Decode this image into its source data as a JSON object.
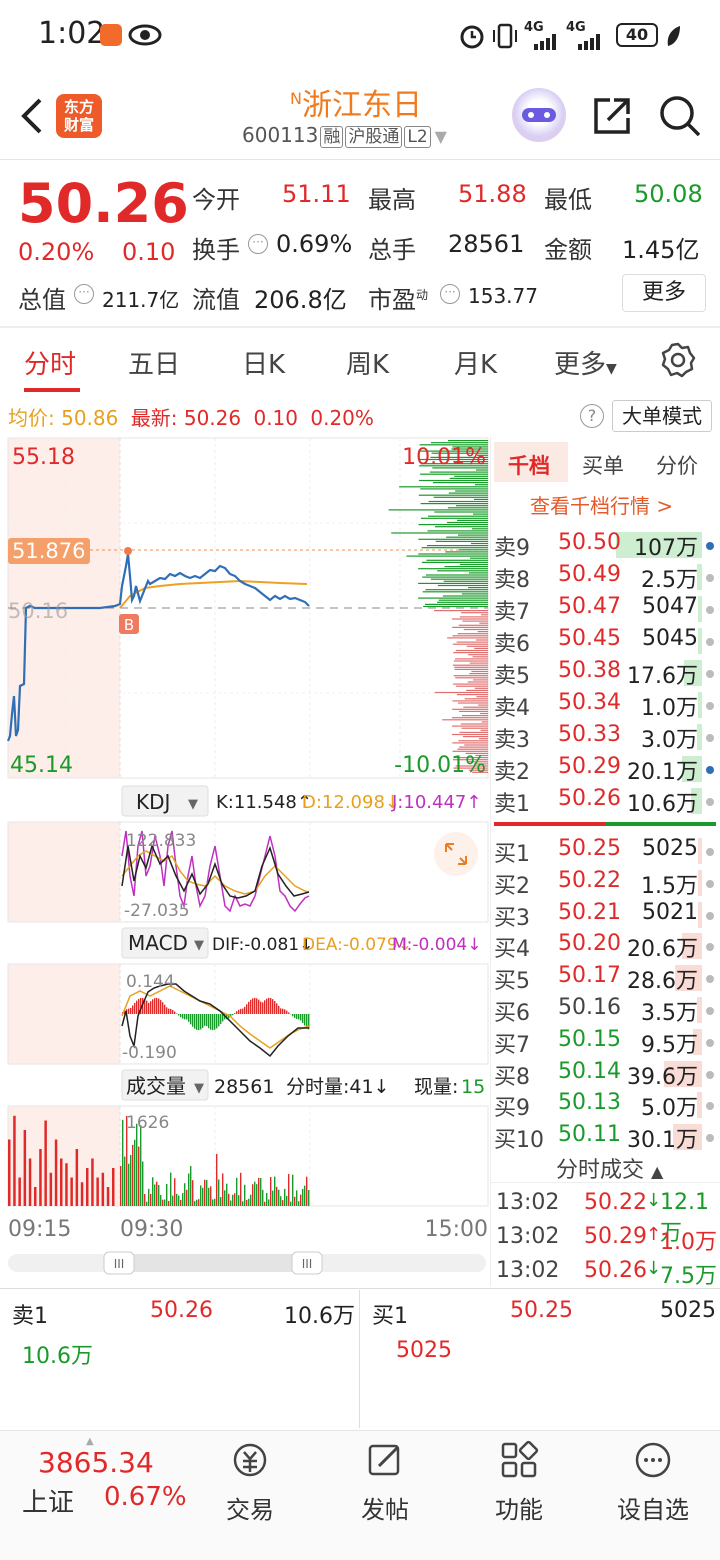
{
  "status": {
    "time": "1:02",
    "battery": "40",
    "net1": "4G",
    "net2": "4G"
  },
  "header": {
    "app_logo": [
      "东方",
      "财富"
    ],
    "name_prefix": "N",
    "name": "浙江东日",
    "code": "600113",
    "tags": [
      "融",
      "沪股通",
      "L2"
    ]
  },
  "quote": {
    "price": "50.26",
    "pct": "0.20%",
    "chg": "0.10",
    "open_label": "今开",
    "open": "51.11",
    "high_label": "最高",
    "high": "51.88",
    "low_label": "最低",
    "low": "50.08",
    "turnover_label": "换手",
    "turnover": "0.69%",
    "vol_label": "总手",
    "vol": "28561",
    "amount_label": "金额",
    "amount": "1.45亿",
    "mcap_label": "总值",
    "mcap": "211.7亿",
    "float_label": "流值",
    "float": "206.8亿",
    "pe_label": "市盈",
    "pe_sup": "动",
    "pe": "153.77",
    "more": "更多"
  },
  "tabs": [
    "分时",
    "五日",
    "日K",
    "周K",
    "月K",
    "更多"
  ],
  "avg_row": {
    "avg_label": "均价:",
    "avg": "50.86",
    "latest_label": "最新:",
    "latest": "50.26",
    "chg": "0.10",
    "pct": "0.20%"
  },
  "big_order_btn": "大单模式",
  "chart": {
    "y_top": "55.18",
    "y_bottom": "45.14",
    "pct_top": "10.01%",
    "pct_bottom": "-10.01%",
    "marker_price": "51.876",
    "base_price": "50.16",
    "b_marker": "B",
    "kdj": {
      "name": "KDJ",
      "k": "K:11.548↑",
      "d": "D:12.098↓",
      "j": "J:10.447↑",
      "max": "122.833",
      "min": "-27.035"
    },
    "macd": {
      "name": "MACD",
      "dif": "DIF:-0.081↓",
      "dea": "DEA:-0.079↓",
      "m": "M:-0.004↓",
      "max": "0.144",
      "min": "-0.190"
    },
    "vol": {
      "name": "成交量",
      "total": "28561",
      "tick_label": "分时量:41↓",
      "now_label": "现量:",
      "now": "15",
      "max": "1626"
    },
    "time_start": "09:15",
    "time_mid": "09:30",
    "time_end": "15:00"
  },
  "orderbook": {
    "tabs": [
      "千档",
      "买单",
      "分价"
    ],
    "link": "查看千档行情 >",
    "asks": [
      {
        "label": "卖9",
        "price": "50.50",
        "vol": "107万",
        "bar": 0.95,
        "color": "red"
      },
      {
        "label": "卖8",
        "price": "50.49",
        "vol": "2.5万",
        "bar": 0.05,
        "color": "red"
      },
      {
        "label": "卖7",
        "price": "50.47",
        "vol": "5047",
        "bar": 0.01,
        "color": "red"
      },
      {
        "label": "卖6",
        "price": "50.45",
        "vol": "5045",
        "bar": 0.01,
        "color": "red"
      },
      {
        "label": "卖5",
        "price": "50.38",
        "vol": "17.6万",
        "bar": 0.2,
        "color": "red"
      },
      {
        "label": "卖4",
        "price": "50.34",
        "vol": "1.0万",
        "bar": 0.03,
        "color": "red"
      },
      {
        "label": "卖3",
        "price": "50.33",
        "vol": "3.0万",
        "bar": 0.05,
        "color": "red"
      },
      {
        "label": "卖2",
        "price": "50.29",
        "vol": "20.1万",
        "bar": 0.22,
        "color": "red"
      },
      {
        "label": "卖1",
        "price": "50.26",
        "vol": "10.6万",
        "bar": 0.12,
        "color": "red"
      }
    ],
    "bids": [
      {
        "label": "买1",
        "price": "50.25",
        "vol": "5025",
        "bar": 0.01,
        "color": "red"
      },
      {
        "label": "买2",
        "price": "50.22",
        "vol": "1.5万",
        "bar": 0.03,
        "color": "red"
      },
      {
        "label": "买3",
        "price": "50.21",
        "vol": "5021",
        "bar": 0.01,
        "color": "red"
      },
      {
        "label": "买4",
        "price": "50.20",
        "vol": "20.6万",
        "bar": 0.22,
        "color": "red"
      },
      {
        "label": "买5",
        "price": "50.17",
        "vol": "28.6万",
        "bar": 0.3,
        "color": "red"
      },
      {
        "label": "买6",
        "price": "50.16",
        "vol": "3.5万",
        "bar": 0.05,
        "color": "gray"
      },
      {
        "label": "买7",
        "price": "50.15",
        "vol": "9.5万",
        "bar": 0.1,
        "color": "green"
      },
      {
        "label": "买8",
        "price": "50.14",
        "vol": "39.6万",
        "bar": 0.42,
        "color": "green"
      },
      {
        "label": "买9",
        "price": "50.13",
        "vol": "5.0万",
        "bar": 0.06,
        "color": "green"
      },
      {
        "label": "买10",
        "price": "50.11",
        "vol": "30.1万",
        "bar": 0.32,
        "color": "green"
      }
    ],
    "trades_title": "分时成交",
    "trades": [
      {
        "time": "13:02",
        "price": "50.22",
        "arrow": "↓",
        "vol": "12.1万"
      },
      {
        "time": "13:02",
        "price": "50.29",
        "arrow": "↑",
        "vol": "1.0万"
      },
      {
        "time": "13:02",
        "price": "50.26",
        "arrow": "↓",
        "vol": "7.5万"
      }
    ]
  },
  "level1": {
    "sell_label": "卖1",
    "sell_price": "50.26",
    "sell_vol": "10.6万",
    "sell_sub": "10.6万",
    "buy_label": "买1",
    "buy_price": "50.25",
    "buy_vol": "5025",
    "buy_sub": "5025"
  },
  "bottom_nav": {
    "index_value": "3865.34",
    "index_name": "上证",
    "index_pct": "0.67%",
    "items": [
      "交易",
      "发帖",
      "功能",
      "设自选"
    ]
  }
}
